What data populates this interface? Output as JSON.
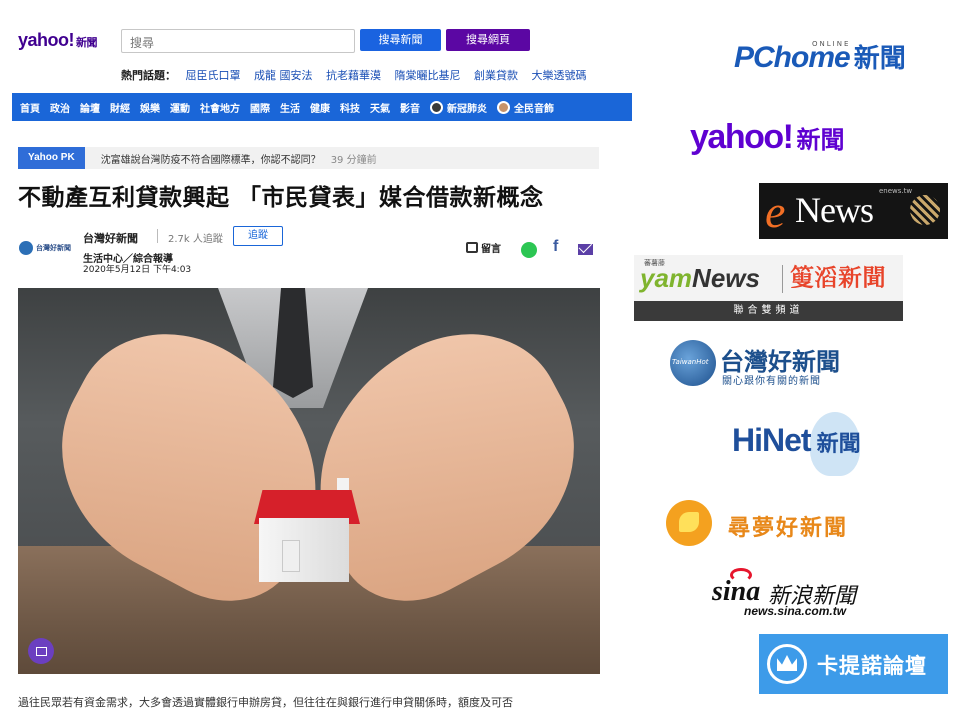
{
  "yahoo_page": {
    "logo": {
      "brand": "yahoo!",
      "sub": "新聞"
    },
    "search": {
      "placeholder": "搜尋",
      "news_button": "搜尋新聞",
      "web_button": "搜尋網頁"
    },
    "hot_topics": {
      "label": "熱門話題：",
      "items": [
        "屈臣氏口罩",
        "成龍 國安法",
        "抗老藉華漠",
        "隋棠曬比基尼",
        "創業貸款",
        "大樂透號碼"
      ]
    },
    "nav": {
      "items": [
        "首頁",
        "政治",
        "論壇",
        "財經",
        "娛樂",
        "運動",
        "社會地方",
        "國際",
        "生活",
        "健康",
        "科技",
        "天氣",
        "影音"
      ],
      "special": [
        {
          "label": "新冠肺炎",
          "icon": "virus-icon"
        },
        {
          "label": "全民音飾",
          "icon": "avatar-icon"
        }
      ]
    },
    "pk": {
      "tag": "Yahoo PK",
      "text": "沈富雄說台灣防疫不符合國際標準，你認不認同？",
      "time": "39 分鐘前"
    },
    "article": {
      "headline": "不動產互利貸款興起 「市民貸表」媒合借款新概念",
      "source_logo_text": "台灣好新聞",
      "author": "台灣好新聞",
      "followers": "2.7k 人追蹤",
      "follow_button": "追蹤",
      "byline": "生活中心／綜合報導",
      "date": "2020年5月12日 下午4:03",
      "comment_label": "留言",
      "snippet": "過往民眾若有資金需求，大多會透過實體銀行申辦房貸，但往往在與銀行進行申貸關係時，額度及可否"
    }
  },
  "news_logos": [
    {
      "name": "pchome",
      "brand": "PChome",
      "online": "ONLINE",
      "suffix": "新聞"
    },
    {
      "name": "yahoo",
      "brand": "yahoo!",
      "suffix": "新聞"
    },
    {
      "name": "enews",
      "e": "e",
      "brand": "News",
      "small": "enews.tw"
    },
    {
      "name": "yam",
      "fan": "蕃薯藤",
      "brand_a": "yam",
      "brand_b": "News",
      "tao": "𥰞滔新聞",
      "bar": "聯合雙頻道"
    },
    {
      "name": "taiwanhot",
      "circle": "TaiwanHot",
      "title": "台灣好新聞",
      "sub": "關心跟你有關的新聞"
    },
    {
      "name": "hinet",
      "brand": "HiNet",
      "suffix": "新聞"
    },
    {
      "name": "xunmeng",
      "title": "尋夢好新聞"
    },
    {
      "name": "sina",
      "brand": "sina",
      "title": "新浪新聞",
      "url": "news.sina.com.tw"
    },
    {
      "name": "ptt",
      "title": "卡提諾論壇"
    }
  ],
  "colors": {
    "yahoo_purple": "#5f01d1",
    "nav_blue": "#1a66d8",
    "pchome_blue": "#1a5ab8",
    "enews_orange": "#f26f25",
    "sina_red": "#e6162d",
    "ptt_blue": "#3d9be9"
  }
}
